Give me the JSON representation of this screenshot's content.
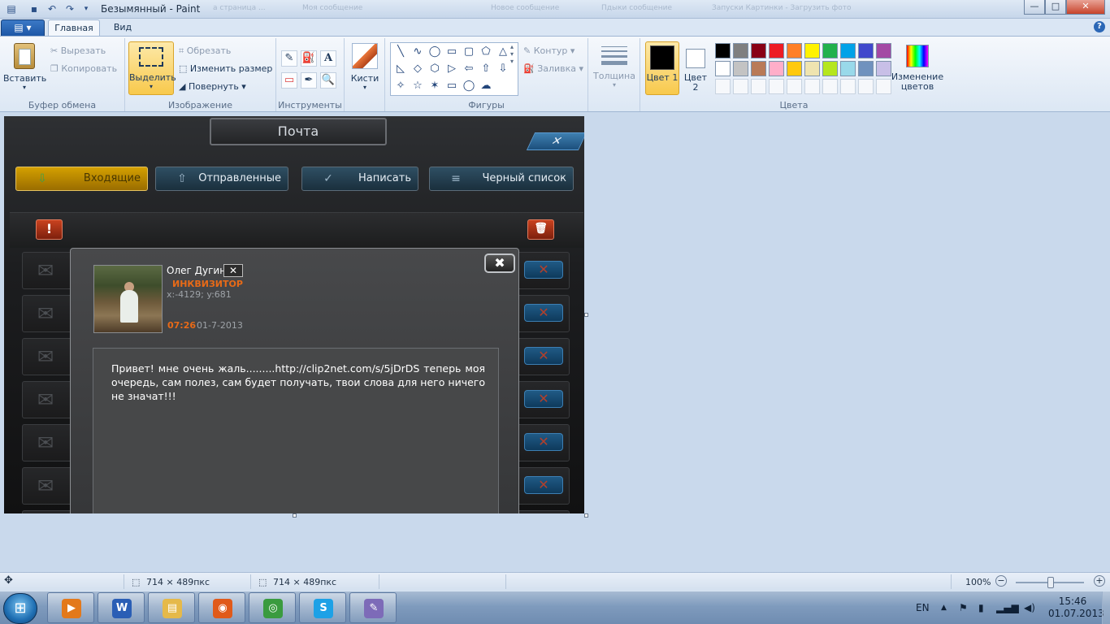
{
  "window": {
    "title": "Безымянный - Paint",
    "ghost_tabs": [
      "а страница ...",
      "Моя сообщение",
      "Новое сообщение",
      "Пдыки сообщение",
      "Посмотреть",
      "Запуски Картинки - Загрузить фото"
    ],
    "controls": {
      "minimize": "—",
      "maximize": "□",
      "close": "✕"
    }
  },
  "menu": {
    "file": "▤ ▾",
    "tabs": [
      "Главная",
      "Вид"
    ],
    "help": "?"
  },
  "ribbon": {
    "clipboard": {
      "paste": "Вставить",
      "cut": "Вырезать",
      "copy": "Копировать",
      "label": "Буфер обмена"
    },
    "image": {
      "select": "Выделить",
      "crop": "Обрезать",
      "resize": "Изменить размер",
      "rotate": "Повернуть",
      "label": "Изображение"
    },
    "tools": {
      "label": "Инструменты",
      "items": [
        "✎",
        "⛽",
        "A",
        "▭",
        "✒",
        "🔍"
      ]
    },
    "brushes": {
      "label": "Кисти"
    },
    "shapes": {
      "label": "Фигуры",
      "outline": "Контур",
      "fill": "Заливка",
      "glyphs": [
        "╲",
        "∿",
        "◯",
        "▭",
        "▢",
        "⬠",
        "△",
        "◺",
        "◇",
        "⬡",
        "▷",
        "⇦",
        "⇧",
        "⇩",
        "✧",
        "☆",
        "✶",
        "▭",
        "◯",
        "☁"
      ]
    },
    "size": {
      "label": "Толщина"
    },
    "colors": {
      "label": "Цвета",
      "color1": "Цвет 1",
      "color2": "Цвет 2",
      "edit": "Изменение цветов",
      "color1_value": "#000000",
      "color2_value": "#ffffff",
      "palette_row1": [
        "#000000",
        "#7f7f7f",
        "#880015",
        "#ed1c24",
        "#ff7f27",
        "#fff200",
        "#22b14c",
        "#00a2e8",
        "#3f48cc",
        "#a349a4"
      ],
      "palette_row2": [
        "#ffffff",
        "#c3c3c3",
        "#b97a57",
        "#ffaec9",
        "#ffc90e",
        "#efe4b0",
        "#b5e61d",
        "#99d9ea",
        "#7092be",
        "#c8bfe7"
      ]
    }
  },
  "game": {
    "title": "Почта",
    "close": "✕",
    "tabs": [
      {
        "label": "Входящие",
        "icon": "⇩"
      },
      {
        "label": "Отправленные",
        "icon": "⇧"
      },
      {
        "label": "Написать",
        "icon": "✓"
      },
      {
        "label": "Черный список",
        "icon": "≡"
      }
    ],
    "alert_btn": "!",
    "trash_btn": "🗑",
    "row_close": "✕",
    "popup": {
      "close": "✖",
      "username": "Олег Дугин",
      "user_x": "✕",
      "rank": "ИНКВИЗИТОР",
      "coords": "x:-4129; y:681",
      "time": "07:26",
      "date": "01-7-2013",
      "message": "Привет! мне очень жаль.........http://clip2net.com/s/5jDrDS теперь моя очередь, сам полез, сам будет получать, твои слова для него ничего не значат!!!"
    }
  },
  "status": {
    "move_icon": "✥",
    "selection_size": "714 × 489пкс",
    "image_size": "714 × 489пкс",
    "zoom": "100%",
    "zoom_out": "−",
    "zoom_in": "+"
  },
  "taskbar": {
    "apps": [
      {
        "name": "media",
        "glyph": "▶",
        "color": "#e3791b"
      },
      {
        "name": "word",
        "glyph": "W",
        "color": "#2a5eb5"
      },
      {
        "name": "explorer",
        "glyph": "▤",
        "color": "#e5b94a"
      },
      {
        "name": "firefox",
        "glyph": "◉",
        "color": "#e05a1a"
      },
      {
        "name": "chrome",
        "glyph": "◎",
        "color": "#3a9b3f"
      },
      {
        "name": "skype",
        "glyph": "S",
        "color": "#1da1e6"
      },
      {
        "name": "paint",
        "glyph": "✎",
        "color": "#7d6bb8"
      }
    ],
    "lang": "EN",
    "time": "15:46",
    "date": "01.07.2013"
  }
}
